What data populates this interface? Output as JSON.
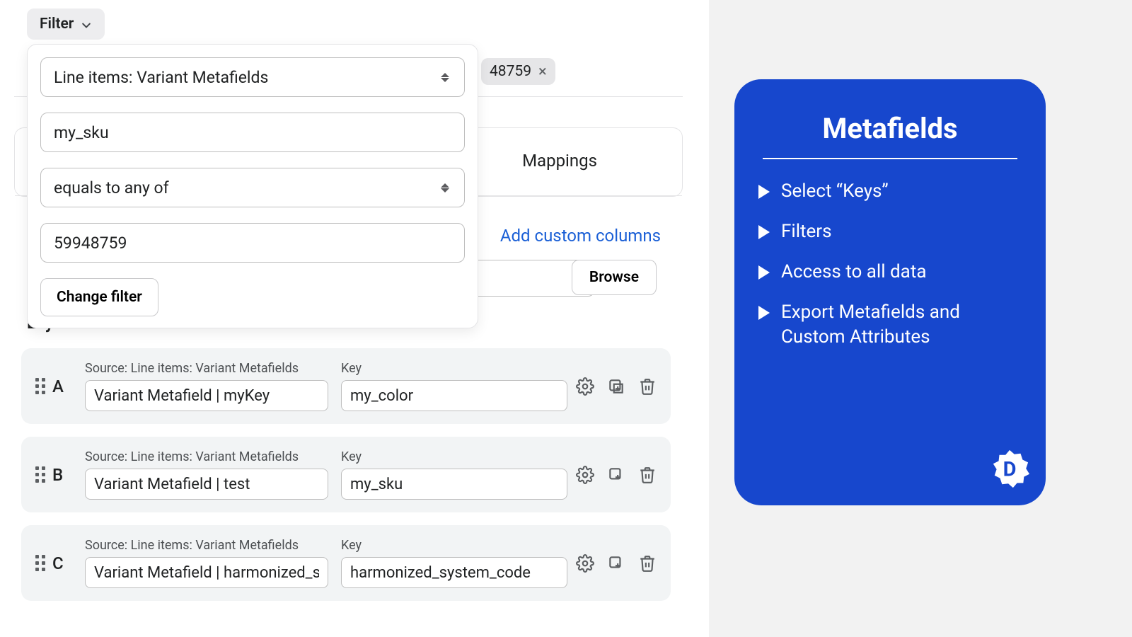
{
  "filter_button": "Filter",
  "popover": {
    "field_select": "Line items: Variant Metafields",
    "key_value": "my_sku",
    "operator": "equals to any of",
    "filter_value": "59948759",
    "change_filter": "Change filter"
  },
  "chip": {
    "text": "48759"
  },
  "tabs": {
    "mappings": "Mappings"
  },
  "add_columns": "Add custom columns",
  "browse": "Browse",
  "layout_label": "Layout",
  "rows": [
    {
      "letter": "A",
      "source": "Source: Line items: Variant Metafields",
      "name": "Variant Metafield | myKey",
      "key_label": "Key",
      "key": "my_color"
    },
    {
      "letter": "B",
      "source": "Source: Line items: Variant Metafields",
      "name": "Variant Metafield | test",
      "key_label": "Key",
      "key": "my_sku"
    },
    {
      "letter": "C",
      "source": "Source: Line items: Variant Metafields",
      "name": "Variant Metafield | harmonized_sys",
      "key_label": "Key",
      "key": "harmonized_system_code"
    }
  ],
  "promo": {
    "title": "Metafields",
    "items": [
      "Select “Keys”",
      "Filters",
      "Access to all data",
      "Export Metafields and Custom Attributes"
    ],
    "badge_letter": "D"
  }
}
